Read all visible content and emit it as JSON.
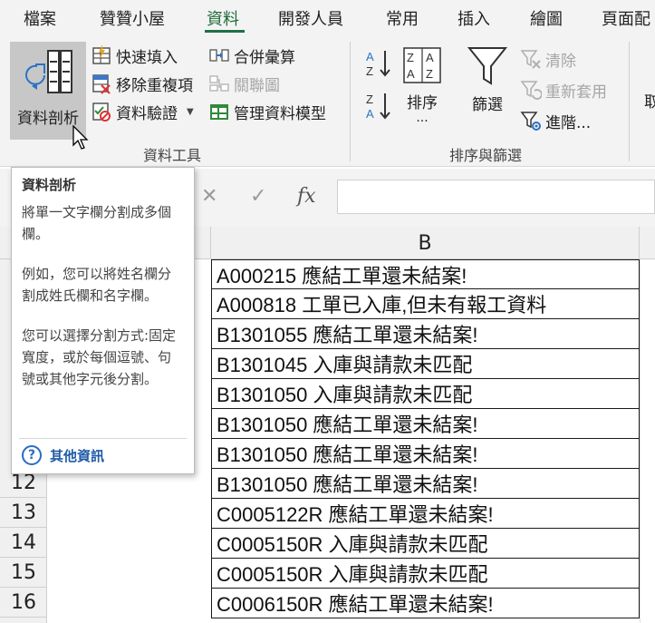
{
  "tabs": [
    "檔案",
    "贊贊小屋",
    "資料",
    "開發人員",
    "常用",
    "插入",
    "繪圖",
    "頁面配"
  ],
  "ribbon": {
    "text_to_columns": "資料剖析",
    "flash_fill": "快速填入",
    "remove_duplicates": "移除重複項",
    "data_validation": "資料驗證",
    "consolidate": "合併彙算",
    "relationships": "關聯圖",
    "manage_data_model": "管理資料模型",
    "group_data_tools": "資料工具",
    "sort": "排序",
    "sort_more": "...",
    "filter": "篩選",
    "clear": "清除",
    "reapply": "重新套用",
    "advanced": "進階...",
    "group_sort_filter": "排序與篩選",
    "cut_label": "取"
  },
  "formula_bar": {
    "cancel": "✕",
    "enter": "✓",
    "fx": "fx"
  },
  "grid": {
    "column_b": "B",
    "row_numbers": [
      "12",
      "13",
      "14",
      "15",
      "16"
    ],
    "cells": [
      "A000215 應結工單還未結案!",
      "A000818 工單已入庫,但未有報工資料",
      "B1301055 應結工單還未結案!",
      "B1301045 入庫與請款未匹配",
      "B1301050 入庫與請款未匹配",
      "B1301050 應結工單還未結案!",
      "B1301050 應結工單還未結案!",
      "B1301050 應結工單還未結案!",
      "C0005122R 應結工單還未結案!",
      "C0005150R 入庫與請款未匹配",
      "C0005150R 入庫與請款未匹配",
      "C0006150R 應結工單還未結案!"
    ]
  },
  "tooltip": {
    "title": "資料剖析",
    "p1": "將單一文字欄分割成多個欄。",
    "p2": "例如，您可以將姓名欄分割成姓氏欄和名字欄。",
    "p3": "您可以選擇分割方式:固定寬度，或於每個逗號、句號或其他字元後分割。",
    "more": "其他資訊"
  }
}
